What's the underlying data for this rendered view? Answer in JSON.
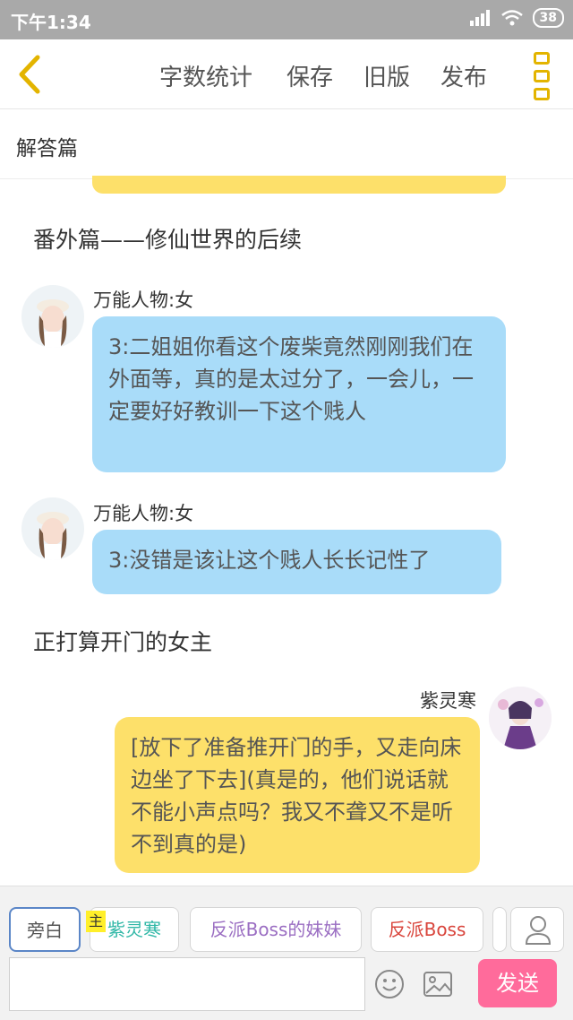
{
  "status_bar": {
    "time": "下午1:34",
    "battery": "38"
  },
  "toolbar": {
    "word_count": "字数统计",
    "save": "保存",
    "old_version": "旧版",
    "publish": "发布"
  },
  "chapter": {
    "title": "解答篇"
  },
  "messages": {
    "narration_1": "番外篇——修仙世界的后续",
    "m1": {
      "speaker": "万能人物:女",
      "text": "3:二姐姐你看这个废柴竟然刚刚我们在外面等，真的是太过分了，一会儿，一定要好好教训一下这个贱人"
    },
    "m2": {
      "speaker": "万能人物:女",
      "text": "3:没错是该让这个贱人长长记性了"
    },
    "narration_2": "正打算开门的女主",
    "m3": {
      "speaker": "紫灵寒",
      "text": "[放下了准备推开门的手，又走向床边坐了下去](真是的，他们说话就不能小声点吗？我又不聋又不是听不到真的是)"
    }
  },
  "roles": {
    "narrator": "旁白",
    "master_tag": "主",
    "role1": "紫灵寒",
    "role2": "反派Boss的妹妹",
    "role3": "反派Boss"
  },
  "composer": {
    "placeholder": "",
    "send": "发送"
  },
  "colors": {
    "accent_yellow": "#e3b400",
    "bubble_blue": "#a9dcf9",
    "bubble_yellow": "#fde06a",
    "send_pink": "#ff6b9b",
    "role1_color": "#2fb7a6",
    "role2_color": "#9a6dc2",
    "role3_color": "#d9453c"
  }
}
